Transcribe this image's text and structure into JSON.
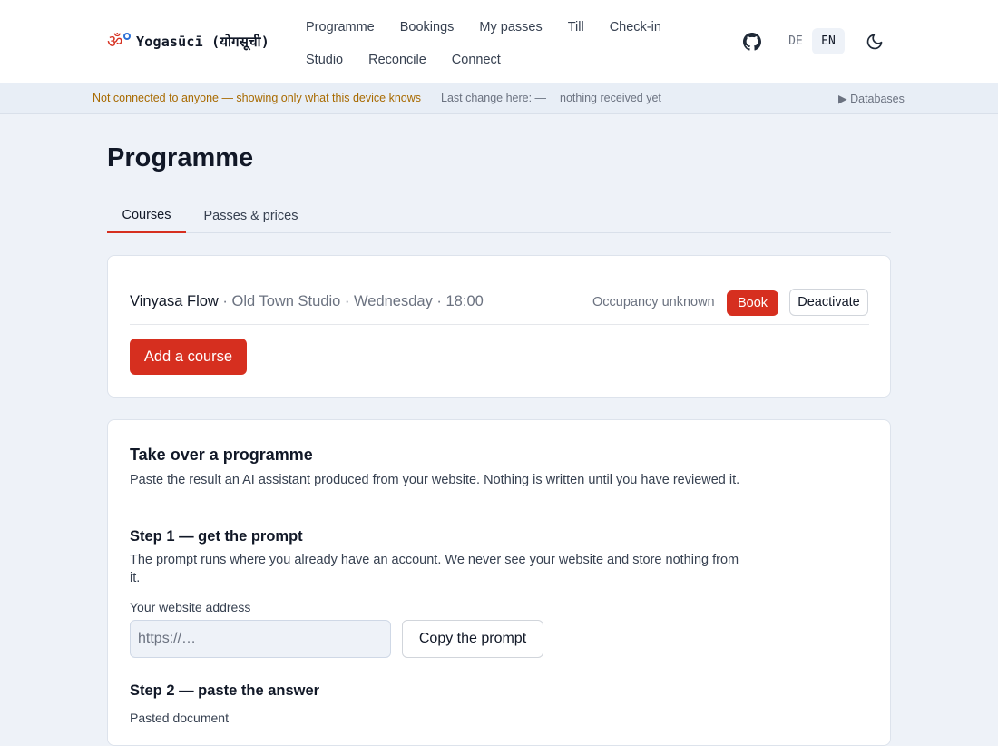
{
  "brand": {
    "name": "Yogasūcī (योगसूची)",
    "logo_glyph": "ॐ"
  },
  "nav": {
    "row1": [
      "Programme",
      "Bookings",
      "My passes",
      "Till",
      "Check-in"
    ],
    "row2": [
      "Studio",
      "Reconcile",
      "Connect"
    ]
  },
  "header_tools": {
    "github_icon": "github-icon",
    "languages": [
      {
        "label": "DE",
        "active": false
      },
      {
        "label": "EN",
        "active": true
      }
    ],
    "theme_icon": "moon-icon"
  },
  "status": {
    "connection": "Not connected to anyone — showing only what this device knows",
    "last_change": "Last change here: —",
    "received": "nothing received yet",
    "databases": "▶ Databases"
  },
  "page": {
    "title": "Programme",
    "tabs": [
      {
        "label": "Courses",
        "active": true
      },
      {
        "label": "Passes & prices",
        "active": false
      }
    ]
  },
  "courses": {
    "items": [
      {
        "name": "Vinyasa Flow",
        "meta": " · Old Town Studio · Wednesday · 18:00",
        "occupancy": "Occupancy unknown",
        "book_label": "Book",
        "deactivate_label": "Deactivate"
      }
    ],
    "add_label": "Add a course"
  },
  "takeover": {
    "title": "Take over a programme",
    "intro": "Paste the result an AI assistant produced from your website. Nothing is written until you have reviewed it.",
    "step1_title": "Step 1 — get the prompt",
    "step1_text": "The prompt runs where you already have an account. We never see your website and store nothing from it.",
    "website_label": "Your website address",
    "website_placeholder": "https://…",
    "website_value": "",
    "copy_label": "Copy the prompt",
    "step2_title": "Step 2 — paste the answer",
    "pasted_label": "Pasted document"
  },
  "colors": {
    "accent": "#d62f1f",
    "warning_text": "#a86a00",
    "background": "#eef2f8"
  }
}
